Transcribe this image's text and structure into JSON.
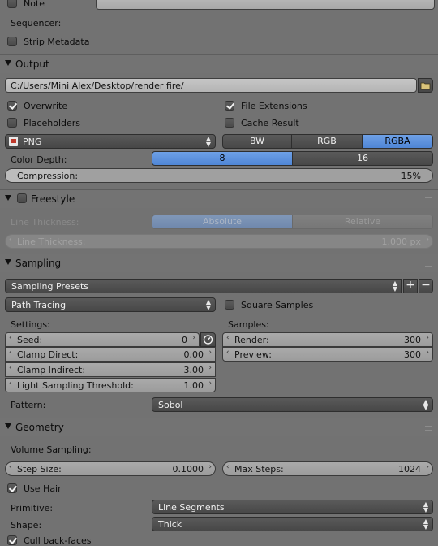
{
  "post": {
    "note_label": "Note",
    "sequencer_label": "Sequencer:",
    "strip_metadata_label": "Strip Metadata"
  },
  "output": {
    "title": "Output",
    "path": "C:/Users/Mini Alex/Desktop/render fire/",
    "overwrite_label": "Overwrite",
    "overwrite": true,
    "file_extensions_label": "File Extensions",
    "file_extensions": true,
    "placeholders_label": "Placeholders",
    "cache_result_label": "Cache Result",
    "format": "PNG",
    "color_modes": [
      "BW",
      "RGB",
      "RGBA"
    ],
    "color_mode_selected": "RGBA",
    "color_depth_label": "Color Depth:",
    "color_depths": [
      "8",
      "16"
    ],
    "color_depth_selected": "8",
    "compression_label": "Compression:",
    "compression_value": "15%",
    "compression_fraction": 0.15
  },
  "freestyle": {
    "title": "Freestyle",
    "line_thickness_label": "Line Thickness:",
    "modes": [
      "Absolute",
      "Relative"
    ],
    "mode_selected": "Absolute",
    "line_thickness_field_label": "Line Thickness:",
    "line_thickness_value": "1.000 px"
  },
  "sampling": {
    "title": "Sampling",
    "presets_label": "Sampling Presets",
    "integrator": "Path Tracing",
    "square_samples_label": "Square Samples",
    "settings_label": "Settings:",
    "samples_label": "Samples:",
    "seed_label": "Seed:",
    "seed_value": "0",
    "clamp_direct_label": "Clamp Direct:",
    "clamp_direct_value": "0.00",
    "clamp_indirect_label": "Clamp Indirect:",
    "clamp_indirect_value": "3.00",
    "light_threshold_label": "Light Sampling Threshold:",
    "light_threshold_value": "1.00",
    "render_label": "Render:",
    "render_value": "300",
    "preview_label": "Preview:",
    "preview_value": "300",
    "pattern_label": "Pattern:",
    "pattern_value": "Sobol"
  },
  "geometry": {
    "title": "Geometry",
    "volume_sampling_label": "Volume Sampling:",
    "step_size_label": "Step Size:",
    "step_size_value": "0.1000",
    "max_steps_label": "Max Steps:",
    "max_steps_value": "1024",
    "use_hair_label": "Use Hair",
    "primitive_label": "Primitive:",
    "primitive_value": "Line Segments",
    "shape_label": "Shape:",
    "shape_value": "Thick",
    "cull_backfaces_label": "Cull back-faces"
  },
  "icons": {
    "collapse": "triangle-down-icon",
    "folder": "folder-icon",
    "image_format": "image-file-icon",
    "dice": "random-seed-icon",
    "add": "plus-icon",
    "remove": "minus-icon",
    "drag": "drag-grip-icon"
  }
}
